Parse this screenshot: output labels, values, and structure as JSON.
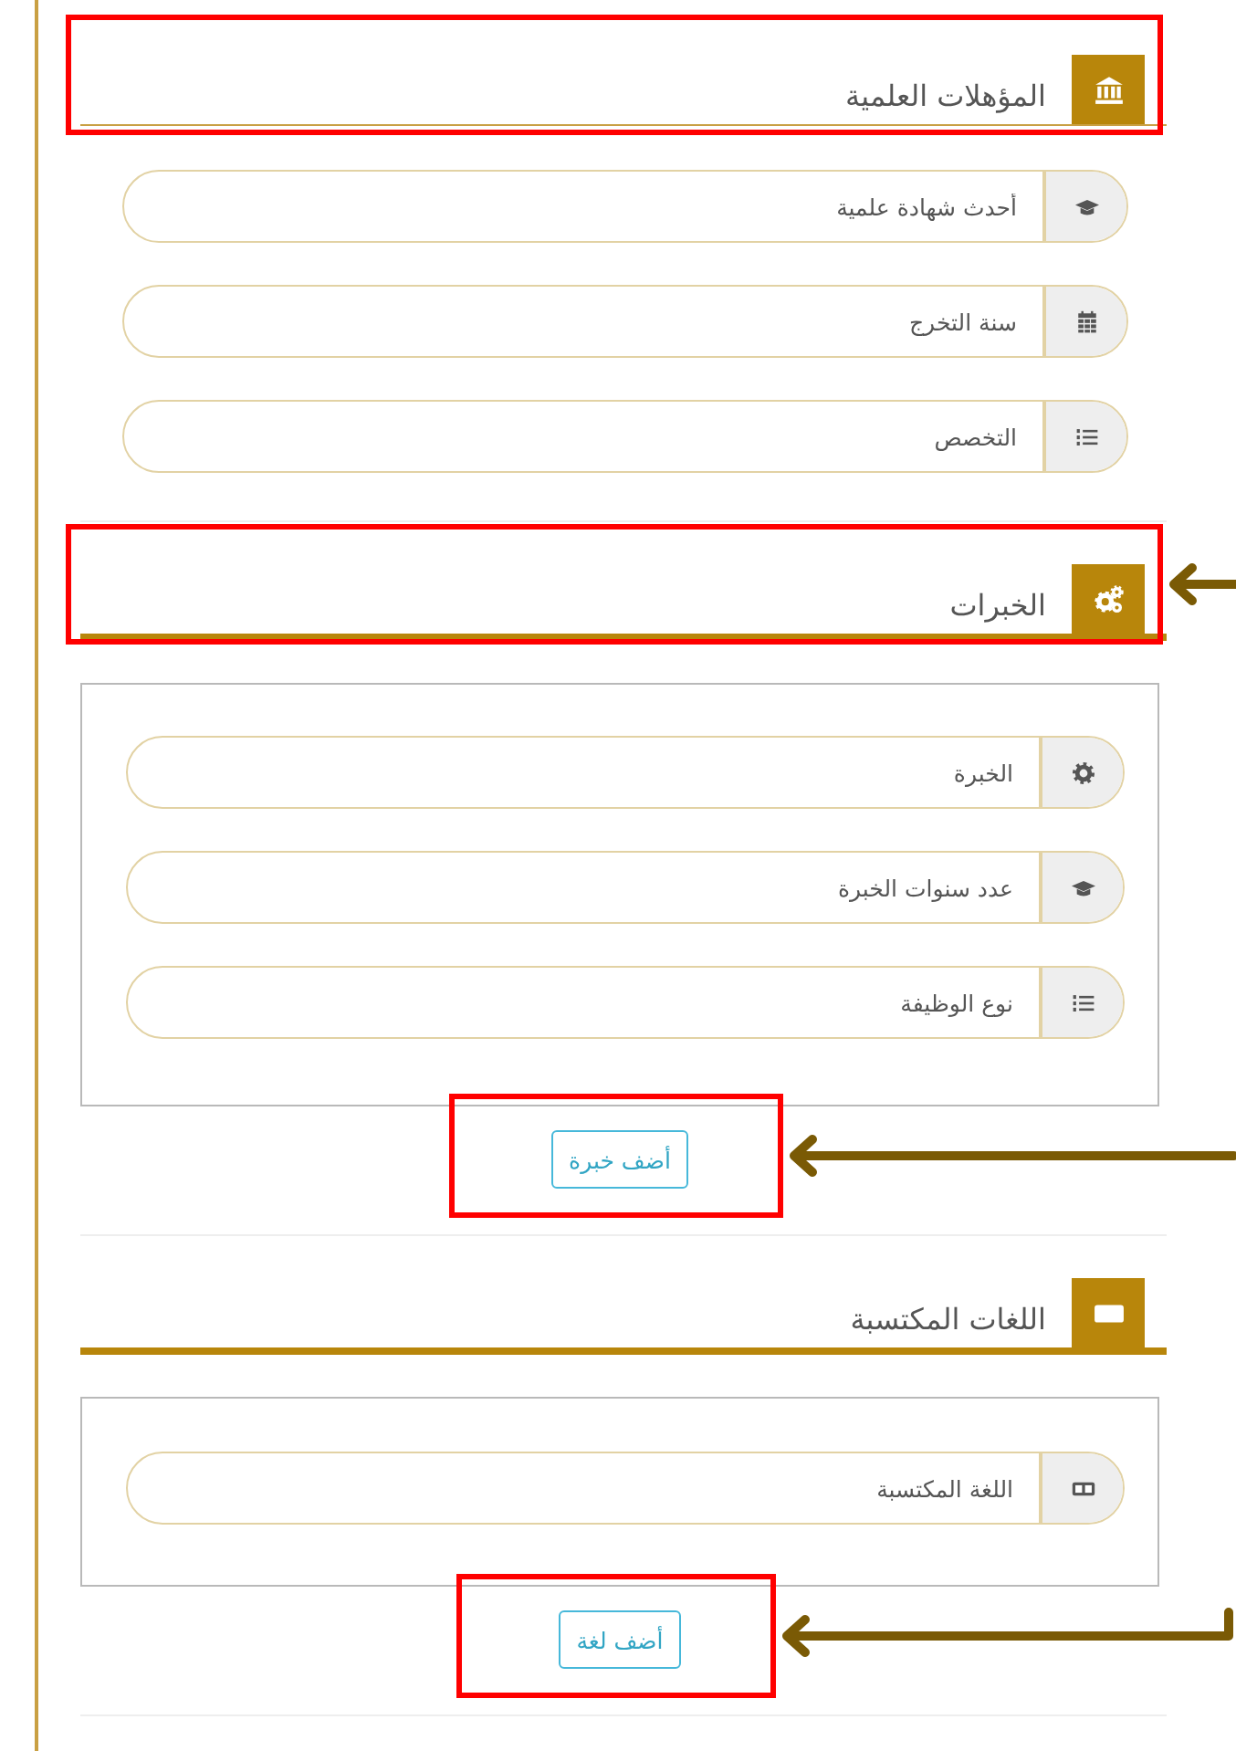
{
  "sections": [
    {
      "title": "المؤهلات العلمية",
      "kind": "single",
      "highlighted": true,
      "fields": [
        {
          "placeholder": "أحدث شهادة علمية"
        },
        {
          "placeholder": "سنة التخرج"
        },
        {
          "placeholder": "التخصص"
        }
      ]
    },
    {
      "title": "الخبرات",
      "kind": "repeatable",
      "highlighted": true,
      "arrow": {
        "kind": "straight"
      },
      "fields": [
        {
          "placeholder": "الخبرة"
        },
        {
          "placeholder": "عدد سنوات الخبرة"
        },
        {
          "placeholder": "نوع الوظيفة"
        }
      ],
      "add_button": {
        "label": "أضف خبرة",
        "highlighted": true,
        "arrow": {
          "kind": "straight"
        }
      }
    },
    {
      "title": "اللغات المكتسبة",
      "kind": "repeatable",
      "highlighted": false,
      "fields": [
        {
          "placeholder": "اللغة المكتسبة"
        }
      ],
      "add_button": {
        "label": "أضف لغة",
        "highlighted": true,
        "arrow": {
          "kind": "elbow"
        }
      }
    }
  ]
}
